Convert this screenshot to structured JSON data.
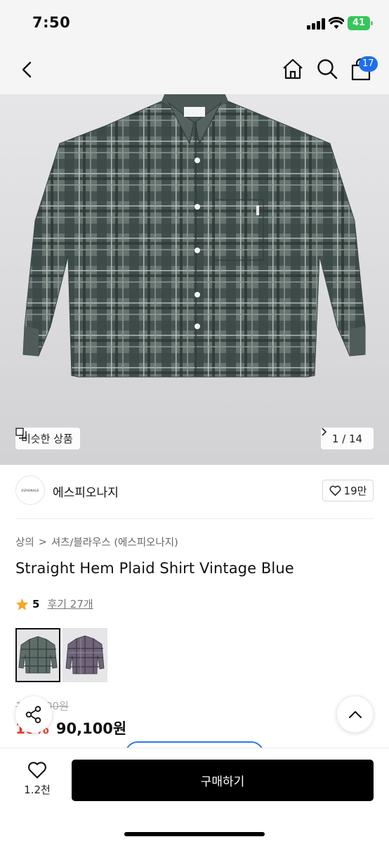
{
  "status_bar": {
    "time": "7:50",
    "battery": "41"
  },
  "nav": {
    "cart_count": "17",
    "icons": [
      "back-icon",
      "home-icon",
      "search-icon",
      "shopping-bag-icon"
    ]
  },
  "gallery": {
    "similar_label": "비슷한 상품",
    "counter": "1 / 14",
    "shirt_colors": {
      "base": "#5f6d69",
      "dark": "#2f3b3a",
      "light": "#a7b2ad"
    }
  },
  "brand": {
    "logo_text": "ESPIONAGE",
    "name": "에스피오나지",
    "likes": "19만"
  },
  "breadcrumb": {
    "category": "상의",
    "separator": ">",
    "subcategory": "셔츠/블라우스 (에스피오나지)"
  },
  "product": {
    "title": "Straight Hem Plaid Shirt Vintage Blue",
    "rating": "5",
    "reviews": "후기 27개",
    "original_price": "100,100원",
    "discount": "10%",
    "price": "90,100원"
  },
  "bottom_bar": {
    "like_count": "1.2천",
    "buy_label": "구매하기"
  },
  "colors": {
    "accent_blue": "#1e6ef0",
    "discount_red": "#ee3b2b",
    "star": "#f5a623"
  }
}
